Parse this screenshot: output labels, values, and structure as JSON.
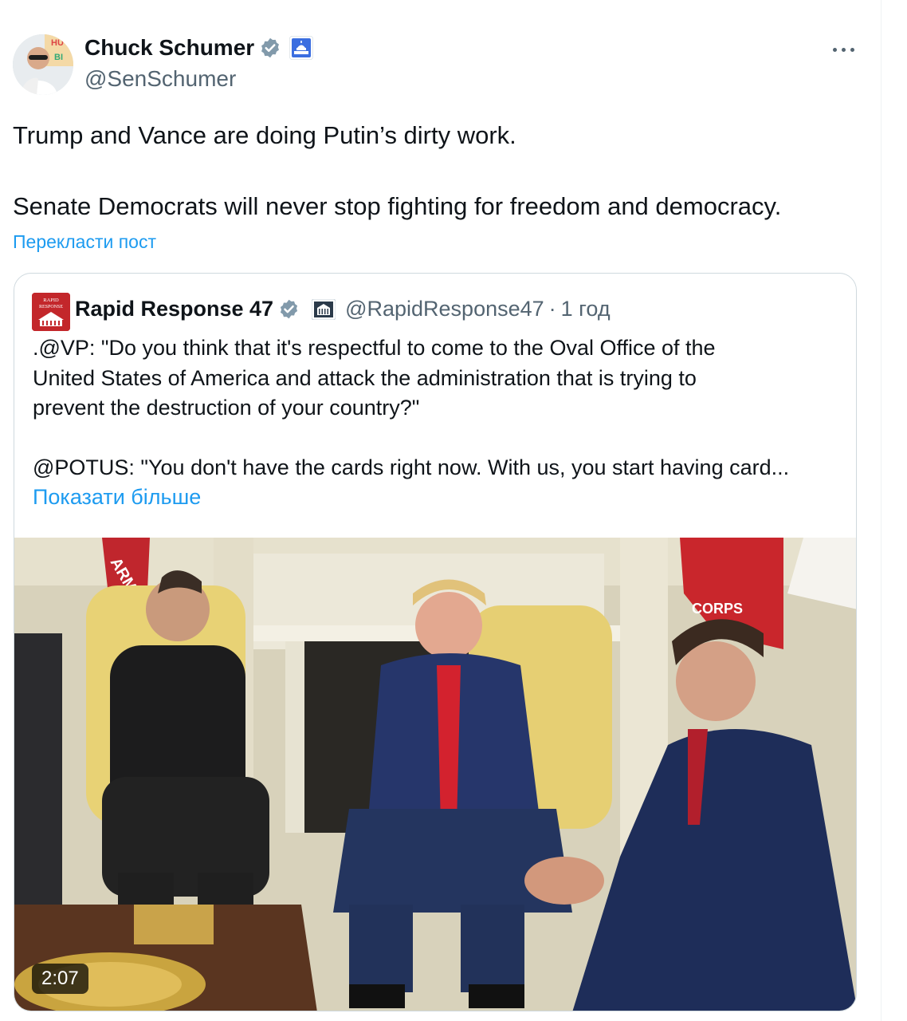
{
  "post": {
    "author": {
      "name": "Chuck Schumer",
      "handle": "@SenSchumer",
      "avatar_icon": "senator-avatar",
      "verified_icon": "verified-badge-icon",
      "affiliation_icon": "us-capitol-badge-icon"
    },
    "text_line_1": "Trump and Vance are doing Putin’s dirty work.",
    "text_line_2": "Senate Democrats will never stop fighting for freedom and democracy.",
    "translate_label": "Перекласти пост",
    "more_icon": "more-options-icon"
  },
  "quote": {
    "author": {
      "name": "Rapid Response 47",
      "handle": "@RapidResponse47",
      "time_sep": "·",
      "time": "1 год",
      "avatar_text": "RAPID RESPONSE"
    },
    "text_line_1": ".@VP: \"Do you think that it's respectful to come to the Oval Office of the",
    "text_line_2": "United States of America and attack the administration that is trying to",
    "text_line_3": "prevent the destruction of your country?\"",
    "text_line_4": "@POTUS: \"You don't have the cards right now. With us, you start having card...",
    "show_more_label": "Показати більше",
    "video": {
      "duration": "2:07",
      "flag_text_left": "ARM",
      "flag_text_right": "CORPS"
    }
  },
  "colors": {
    "link": "#1d9bf0",
    "secondary_text": "#536471",
    "primary_text": "#0f1419",
    "border": "#cfd9de"
  }
}
